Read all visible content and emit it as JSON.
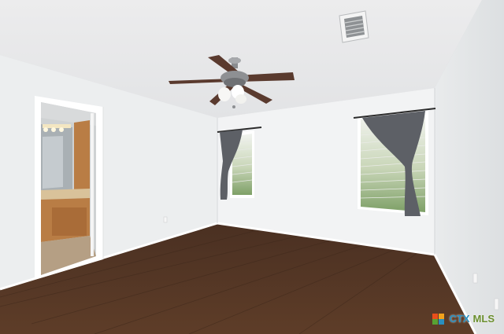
{
  "photo": {
    "description_colors": {
      "ceiling": "#e9eaeb",
      "wall_left": "#eceeef",
      "wall_back": "#f1f2f3",
      "wall_right": "#e4e6e8",
      "floor": "#5a3a26",
      "curtain": "#5d6066",
      "fan_blade": "#5a3a2e",
      "cabinet": "#b97d45"
    },
    "icons": [
      "ceiling-fan-icon",
      "air-vent-icon",
      "window-icon",
      "door-icon"
    ]
  },
  "watermark": {
    "part1": "CTX",
    "part2": "MLS",
    "logo_colors": [
      "#e94e1b",
      "#f3a21c",
      "#58a333",
      "#2a8fbf"
    ]
  }
}
